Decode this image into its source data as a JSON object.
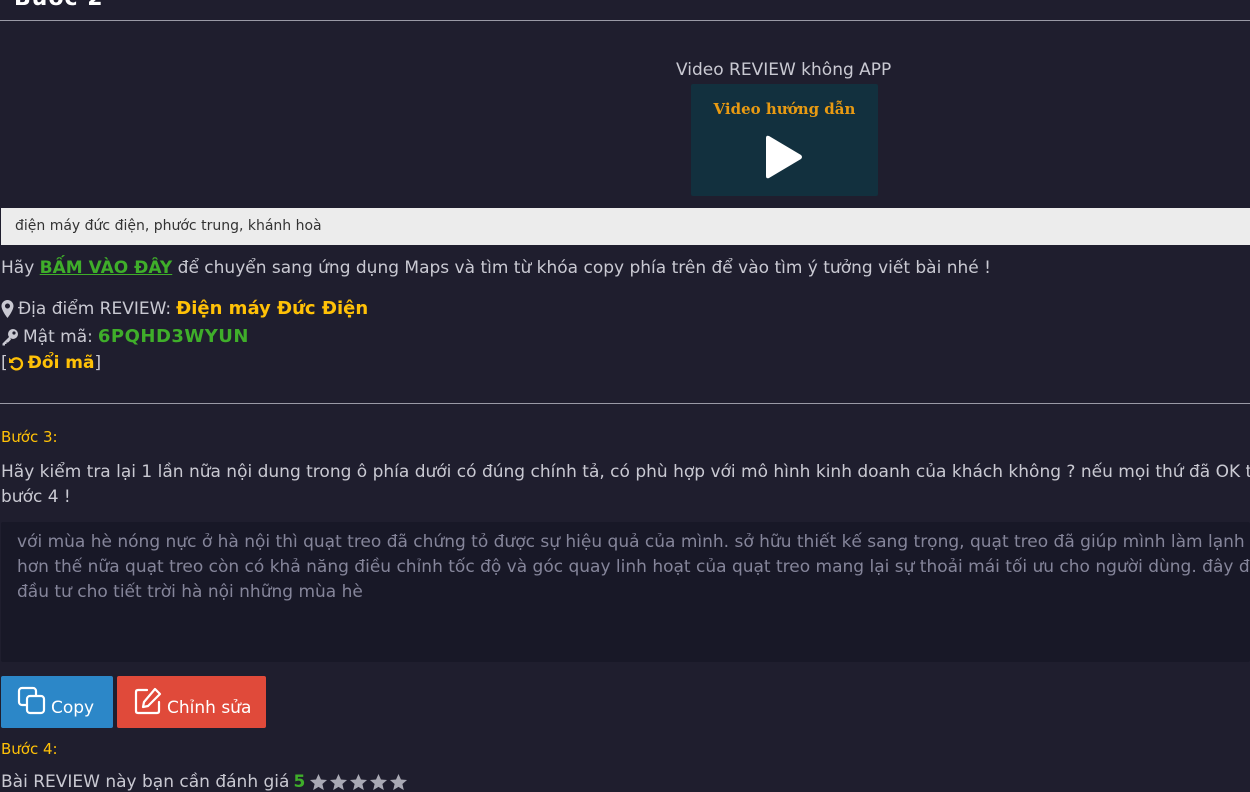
{
  "top_heading": "Bước 2",
  "video": {
    "title": "Video REVIEW không APP",
    "thumbnail_text": "Video hướng dẫn"
  },
  "keyword": {
    "value": "điện máy đức điện, phước trung, khánh hoà"
  },
  "instruction": {
    "prefix": "Hãy ",
    "link": "BẤM VÀO ĐÂY",
    "suffix": " để chuyển sang ứng dụng Maps và tìm từ khóa copy phía trên để vào tìm ý tưởng viết bài nhé !"
  },
  "location": {
    "label": "Địa điểm REVIEW:",
    "name": "Điện máy Đức Điện"
  },
  "password": {
    "label": "Mật mã:",
    "value": "6PQHD3WYUN"
  },
  "change_code": {
    "open_bracket": "[",
    "label": "Đổi mã",
    "close_bracket": "]"
  },
  "step3": {
    "label": "Bước 3:",
    "line1": "Hãy kiểm tra lại 1 lần nữa nội dung trong ô phía dưới có đúng chính tả, có phù hợp với mô hình kinh doanh của khách không ? nếu mọi thứ đã OK thì hãy",
    "line2": "bước 4 !"
  },
  "review": {
    "line1": "với mùa hè nóng nực ở hà nội  thì  quạt treo đã chứng tỏ được sự hiệu quả  của mình. sở hữu thiết kế sang trọng, quạt treo đã giúp mình làm lạnh khô",
    "line2": "hơn thế nữa quạt treo còn có  khả năng điều chỉnh tốc độ và góc quay linh hoạt của quạt treo mang lại sự thoải mái tối ưu cho người dùng. đây đúng",
    "line3": "đầu tư cho tiết trời hà nội những mùa hè"
  },
  "buttons": {
    "copy": "Copy",
    "edit": "Chỉnh sửa"
  },
  "step4": {
    "label": "Bước 4:",
    "text": "Bài REVIEW này bạn cần đánh giá",
    "rating": "5"
  },
  "colors": {
    "background": "#1f1e2e",
    "accent_yellow": "#ffc107",
    "accent_green": "#3fae2a",
    "copy_button": "#2c87c8",
    "edit_button": "#e04a3a"
  }
}
